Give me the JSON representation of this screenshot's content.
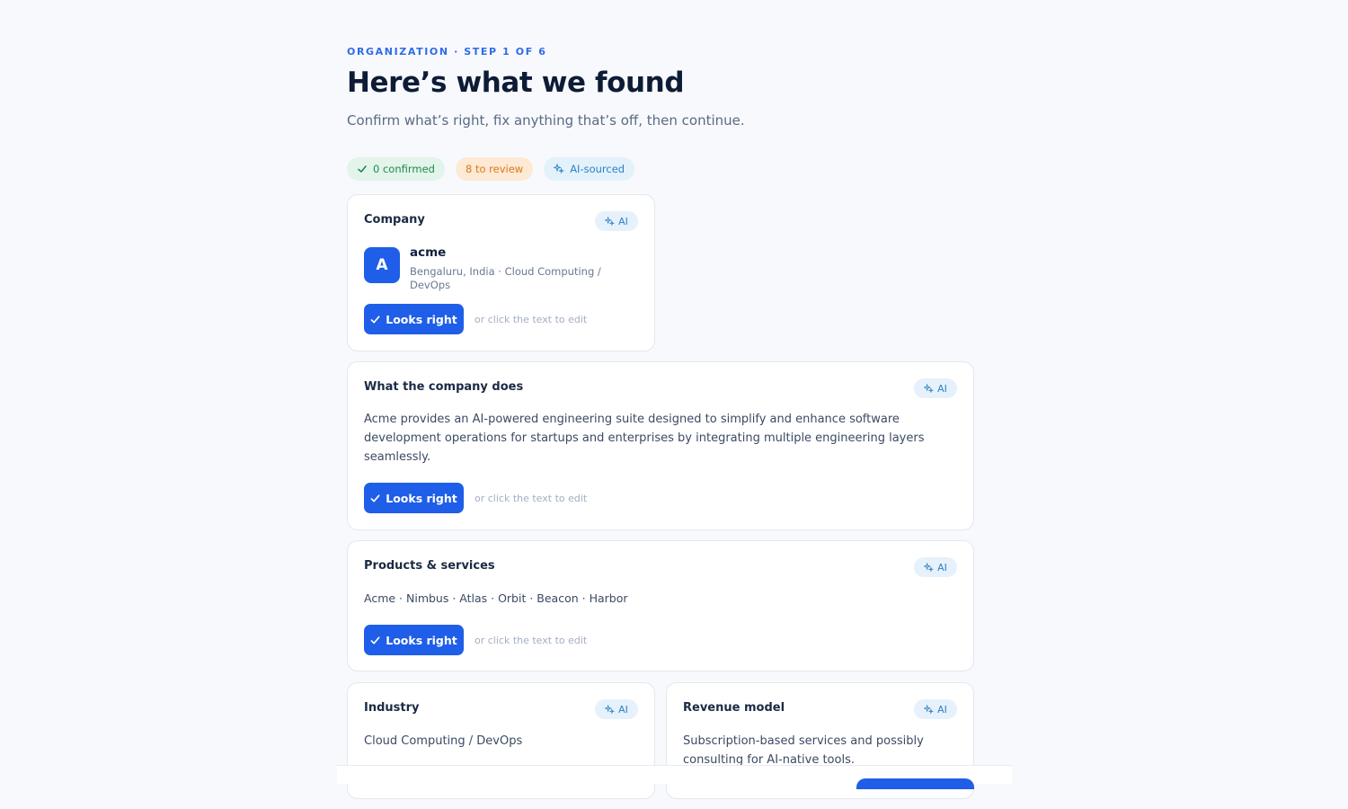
{
  "header": {
    "eyebrow": "ORGANIZATION · STEP 1 OF 6",
    "title": "Here’s what we found",
    "subtitle": "Confirm what’s right, fix anything that’s off, then continue."
  },
  "chips": {
    "confirmed": "0 confirmed",
    "review": "8 to review",
    "ai": "AI-sourced"
  },
  "ai_badge": "AI",
  "confirm_label": "Looks right",
  "edit_hint": "or click the text to edit",
  "company": {
    "title": "Company",
    "avatar": "A",
    "name": "acme",
    "meta": "Bengaluru, India · Cloud Computing / DevOps"
  },
  "description": {
    "title": "What the company does",
    "text": "Acme provides an AI-powered engineering suite designed to simplify and enhance software development operations for startups and enterprises by integrating multiple engineering layers seamlessly."
  },
  "products": {
    "title": "Products & services",
    "text": "Acme · Nimbus · Atlas · Orbit · Beacon · Harbor"
  },
  "industry": {
    "title": "Industry",
    "text": "Cloud Computing / DevOps"
  },
  "revenue": {
    "title": "Revenue model",
    "text": "Subscription-based services and possibly consulting for AI-native tools."
  },
  "colors": {
    "accent": "#1f5ee8",
    "eyebrow": "#2f6bea",
    "confirmed": "#1f8a4c",
    "review": "#d87a1c",
    "ai": "#2c82c4"
  }
}
